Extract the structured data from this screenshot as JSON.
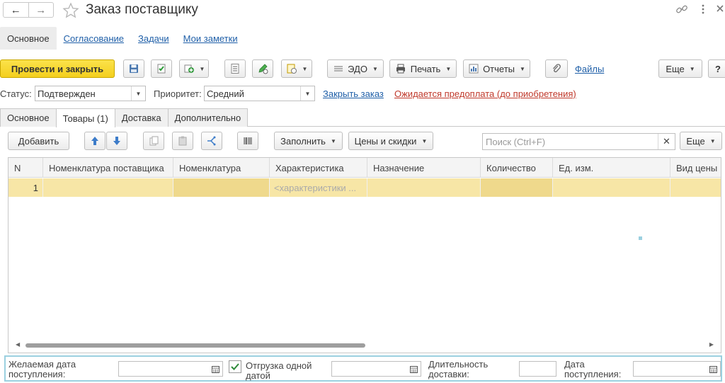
{
  "window": {
    "title": "Заказ поставщику"
  },
  "form_tabs": [
    {
      "label": "Основное",
      "active": true
    },
    {
      "label": "Согласование",
      "active": false
    },
    {
      "label": "Задачи",
      "active": false
    },
    {
      "label": "Мои заметки",
      "active": false
    }
  ],
  "toolbar": {
    "post_close_label": "Провести и закрыть",
    "edo_label": "ЭДО",
    "print_label": "Печать",
    "reports_label": "Отчеты",
    "files_label": "Файлы",
    "more_label": "Еще",
    "help_label": "?"
  },
  "status_row": {
    "status_label": "Статус:",
    "status_value": "Подтвержден",
    "priority_label": "Приоритет:",
    "priority_value": "Средний",
    "close_order_link": "Закрыть заказ",
    "prepay_link": "Ожидается предоплата (до приобретения)"
  },
  "tabs": [
    {
      "label": "Основное",
      "active": false
    },
    {
      "label": "Товары (1)",
      "active": true
    },
    {
      "label": "Доставка",
      "active": false
    },
    {
      "label": "Дополнительно",
      "active": false
    }
  ],
  "table_toolbar": {
    "add_label": "Добавить",
    "fill_label": "Заполнить",
    "prices_label": "Цены и скидки",
    "search_placeholder": "Поиск (Ctrl+F)",
    "more_label": "Еще"
  },
  "table": {
    "columns": [
      "N",
      "Номенклатура поставщика",
      "Номенклатура",
      "Характеристика",
      "Назначение",
      "Количество",
      "Ед. изм.",
      "Вид цены"
    ],
    "rows": [
      [
        "1",
        "",
        "",
        "<характеристики ...",
        "",
        "",
        "",
        ""
      ]
    ]
  },
  "bottom": {
    "desired_date_label": "Желаемая дата поступления:",
    "one_date_label": "Отгрузка одной датой",
    "one_date_checked": true,
    "duration_label": "Длительность доставки:",
    "receipt_date_label": "Дата поступления:"
  },
  "colors": {
    "primary_button": "#f4cf1e",
    "selected_row": "#f7e6a6",
    "link": "#1f5fa8",
    "warning_link": "#c0392b",
    "bottom_highlight": "#9bd0e0"
  }
}
